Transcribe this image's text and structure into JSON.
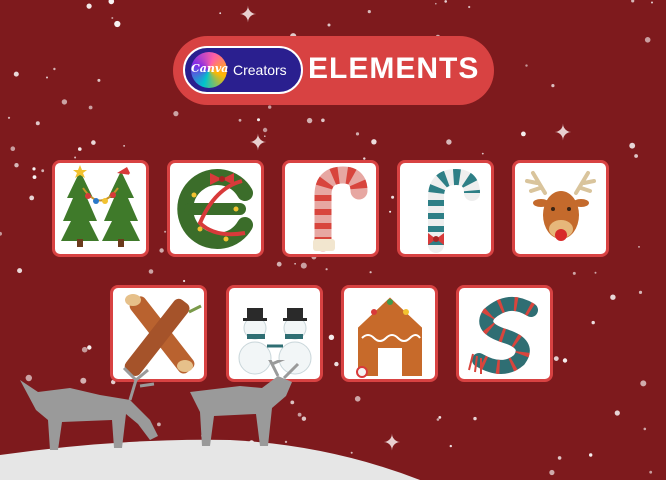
{
  "header": {
    "badge_brand": "Canva",
    "badge_label": "Creators",
    "title": "ELEMENTS"
  },
  "row1": [
    {
      "icon": "christmas-trees-m-icon"
    },
    {
      "icon": "wreath-e-icon"
    },
    {
      "icon": "candy-cane-r-icon"
    },
    {
      "icon": "candy-cane-r-teal-icon"
    },
    {
      "icon": "reindeer-y-icon"
    }
  ],
  "row2": [
    {
      "icon": "log-x-icon"
    },
    {
      "icon": "snowmen-m-icon"
    },
    {
      "icon": "gingerbread-house-a-icon"
    },
    {
      "icon": "scarf-s-icon"
    }
  ],
  "colors": {
    "background": "#7e1a1d",
    "accent": "#d84242",
    "badge": "#2a1f8f"
  }
}
